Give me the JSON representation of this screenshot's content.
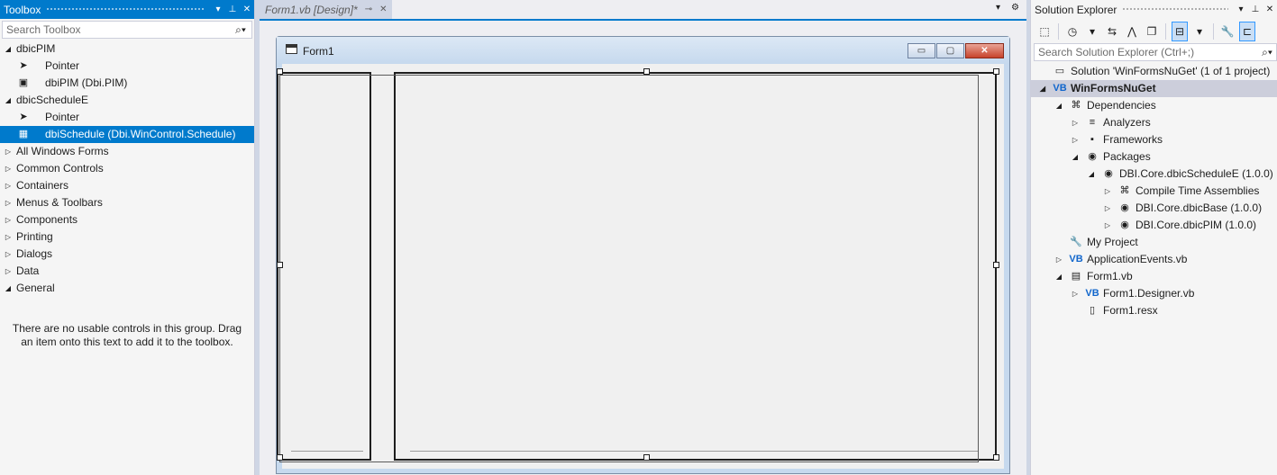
{
  "toolbox": {
    "title": "Toolbox",
    "title_buttons": [
      "▾",
      "⊥",
      "✕"
    ],
    "search_placeholder": "Search Toolbox",
    "groups": [
      {
        "arrow": "◢",
        "label": "dbicPIM"
      },
      {
        "arrow": "",
        "label": "Pointer",
        "icon": "pointer-icon",
        "glyph": "➤"
      },
      {
        "arrow": "",
        "label": "dbiPIM (Dbi.PIM)",
        "icon": "dbipim-component-icon",
        "glyph": "▣"
      },
      {
        "arrow": "◢",
        "label": "dbicScheduleE"
      },
      {
        "arrow": "",
        "label": "Pointer",
        "icon": "pointer-icon",
        "glyph": "➤"
      },
      {
        "arrow": "",
        "label": "dbiSchedule (Dbi.WinControl.Schedule)",
        "icon": "dbischedule-component-icon",
        "glyph": "▦",
        "selected": true
      },
      {
        "arrow": "▷",
        "label": "All Windows Forms"
      },
      {
        "arrow": "▷",
        "label": "Common Controls"
      },
      {
        "arrow": "▷",
        "label": "Containers"
      },
      {
        "arrow": "▷",
        "label": "Menus & Toolbars"
      },
      {
        "arrow": "▷",
        "label": "Components"
      },
      {
        "arrow": "▷",
        "label": "Printing"
      },
      {
        "arrow": "▷",
        "label": "Dialogs"
      },
      {
        "arrow": "▷",
        "label": "Data"
      },
      {
        "arrow": "◢",
        "label": "General"
      }
    ],
    "empty_message": "There are no usable controls in this group. Drag an item onto this text to add it to the toolbox."
  },
  "document": {
    "tab_label": "Form1.vb [Design]*",
    "tab_pin": "⊸",
    "tab_close": "✕",
    "tabbar_dropdown": "▾",
    "tabbar_settings": "⚙",
    "form": {
      "title": "Form1",
      "minimize": "▭",
      "maximize": "▢",
      "close": "✕"
    }
  },
  "solution_explorer": {
    "title": "Solution Explorer",
    "title_buttons": [
      "▾",
      "⊥",
      "✕"
    ],
    "search_placeholder": "Search Solution Explorer (Ctrl+;)",
    "toolbar": [
      "⬚",
      "◷",
      "▾",
      "⇆",
      "⋀",
      "❐",
      "⊟",
      "▾",
      "🔧",
      "⊏"
    ],
    "items": [
      {
        "level": 0,
        "arrow": "",
        "icon": "solution-icon",
        "glyph": "▭",
        "label": "Solution 'WinFormsNuGet' (1 of 1 project)"
      },
      {
        "level": 0,
        "arrow": "◢",
        "icon": "vb-project-icon",
        "glyph": "VB",
        "label": "WinFormsNuGet",
        "project": true
      },
      {
        "level": 1,
        "arrow": "◢",
        "icon": "dependencies-icon",
        "glyph": "⌘",
        "label": "Dependencies"
      },
      {
        "level": 2,
        "arrow": "▷",
        "icon": "analyzers-icon",
        "glyph": "≡",
        "label": "Analyzers"
      },
      {
        "level": 2,
        "arrow": "▷",
        "icon": "frameworks-icon",
        "glyph": "▪",
        "label": "Frameworks"
      },
      {
        "level": 2,
        "arrow": "◢",
        "icon": "packages-icon",
        "glyph": "◉",
        "label": "Packages"
      },
      {
        "level": 3,
        "arrow": "◢",
        "icon": "package-icon",
        "glyph": "◉",
        "label": "DBI.Core.dbicScheduleE (1.0.0)"
      },
      {
        "level": 4,
        "arrow": "▷",
        "icon": "assemblies-icon",
        "glyph": "⌘",
        "label": "Compile Time Assemblies"
      },
      {
        "level": 4,
        "arrow": "▷",
        "icon": "package-icon",
        "glyph": "◉",
        "label": "DBI.Core.dbicBase (1.0.0)"
      },
      {
        "level": 4,
        "arrow": "▷",
        "icon": "package-icon",
        "glyph": "◉",
        "label": "DBI.Core.dbicPIM (1.0.0)"
      },
      {
        "level": 1,
        "arrow": "",
        "icon": "my-project-icon",
        "glyph": "🔧",
        "label": "My Project"
      },
      {
        "level": 1,
        "arrow": "▷",
        "icon": "vb-file-icon",
        "glyph": "VB",
        "label": "ApplicationEvents.vb"
      },
      {
        "level": 1,
        "arrow": "◢",
        "icon": "form-file-icon",
        "glyph": "▤",
        "label": "Form1.vb"
      },
      {
        "level": 2,
        "arrow": "▷",
        "icon": "vb-file-icon",
        "glyph": "VB",
        "label": "Form1.Designer.vb"
      },
      {
        "level": 2,
        "arrow": "",
        "icon": "resx-file-icon",
        "glyph": "▯",
        "label": "Form1.resx"
      }
    ]
  },
  "colors": {
    "accent": "#007acc",
    "selection": "#007acc",
    "panel_bg": "#f5f5f5",
    "form_frame": "#c6d9ee"
  }
}
